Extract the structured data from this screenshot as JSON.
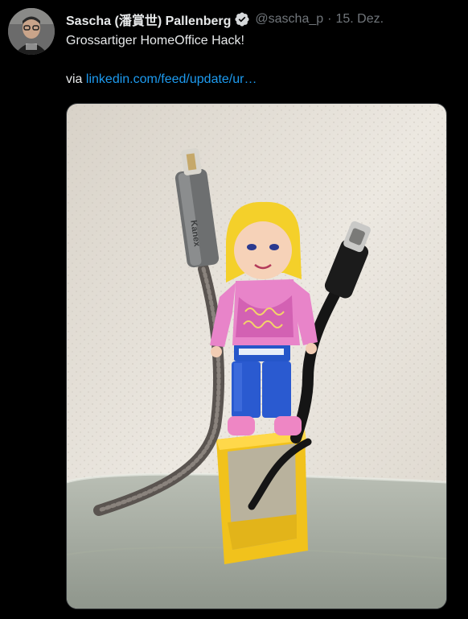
{
  "tweet": {
    "author_name": "Sascha (潘賞世) Pallenberg",
    "handle": "@sascha_p",
    "separator": "·",
    "date": "15. Dez.",
    "text_line1": "Grossartiger HomeOffice Hack!",
    "via_label": "via",
    "link_text": "linkedin.com/feed/update/ur…",
    "media": {
      "cable_brand_text": "Kanex",
      "description_hidden": ""
    }
  },
  "icons": {
    "verified": "verified-badge-icon"
  },
  "colors": {
    "background": "#000000",
    "text": "#e7e9ea",
    "muted": "#71767b",
    "link": "#1d9bf0"
  }
}
